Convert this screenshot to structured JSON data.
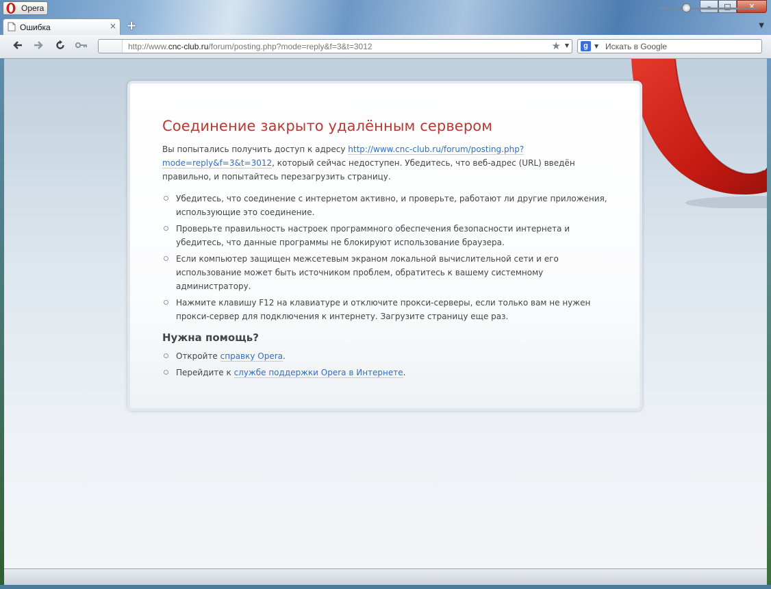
{
  "window": {
    "menu_label": "Opera",
    "controls": {
      "minimize": "–",
      "maximize": "□",
      "close": "✕"
    }
  },
  "tabs": [
    {
      "label": "Ошибка",
      "close": "×"
    }
  ],
  "toolbar": {
    "new_tab": "+",
    "address": {
      "url_prefix": "http://www.",
      "url_host": "cnc-club.ru",
      "url_path": "/forum/posting.php?mode=reply&f=3&t=3012"
    },
    "search": {
      "engine": "g",
      "placeholder": "Искать в Google"
    }
  },
  "error_page": {
    "title": "Соединение закрыто удалённым сервером",
    "intro_before": "Вы попытались получить доступ к адресу ",
    "intro_link": "http://www.cnc-club.ru/forum/posting.php?mode=reply&f=3&t=3012",
    "intro_after": ", который сейчас недоступен. Убедитесь, что веб-адрес (URL) введён правильно, и попытайтесь перезагрузить страницу.",
    "tips": [
      "Убедитесь, что соединение с интернетом активно, и проверьте, работают ли другие приложения, использующие это соединение.",
      "Проверьте правильность настроек программного обеспечения безопасности интернета и убедитесь, что данные программы не блокируют использование браузера.",
      "Если компьютер защищен межсетевым экраном локальной вычислительной сети и его использование может быть источником проблем, обратитесь к вашему системному администратору.",
      "Нажмите клавишу F12 на клавиатуре и отключите прокси-серверы, если только вам не нужен прокси-сервер для подключения к интернету. Загрузите страницу еще раз."
    ],
    "help_title": "Нужна помощь?",
    "help_items": [
      {
        "before": "Откройте ",
        "link": "справку Opera",
        "after": "."
      },
      {
        "before": "Перейдите к ",
        "link": "службе поддержки Opera в Интернете",
        "after": "."
      }
    ]
  },
  "status": {
    "zoom_fraction": 0.28
  },
  "colors": {
    "title_red": "#b33b35",
    "link_blue": "#2f6fc5",
    "opera_red": "#cc1f14"
  }
}
